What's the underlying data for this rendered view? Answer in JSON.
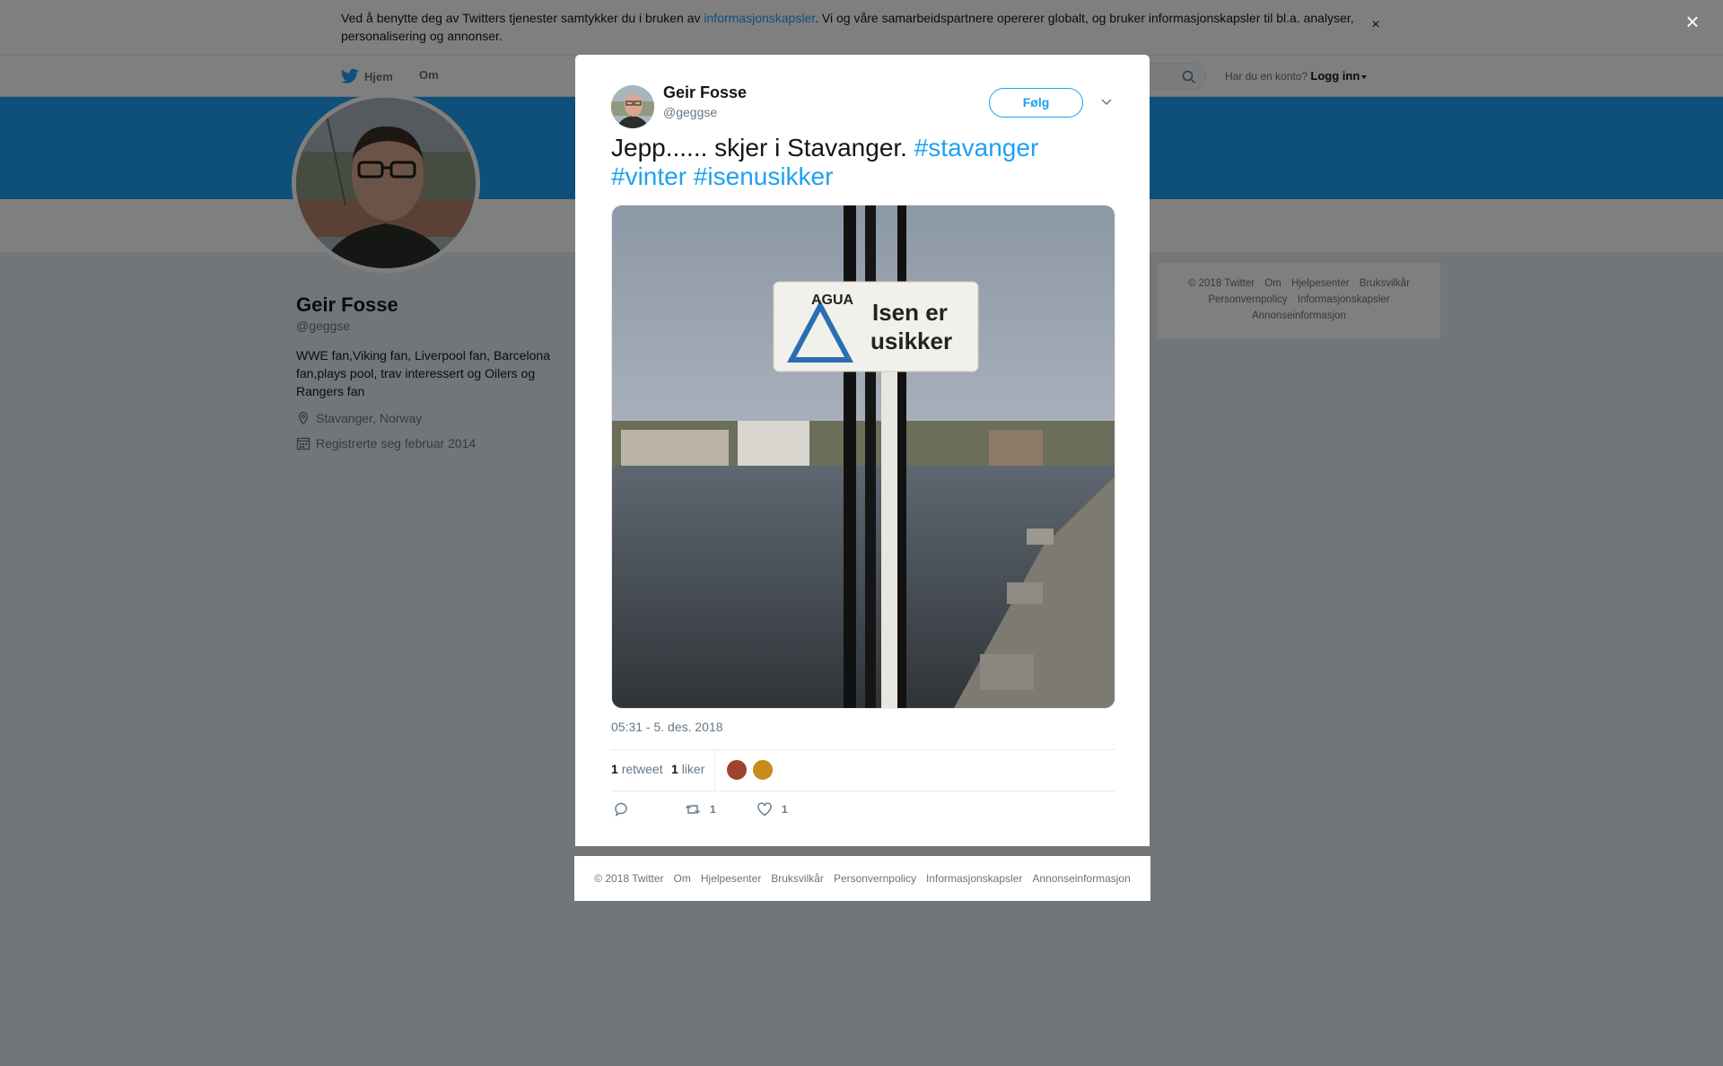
{
  "cookie_banner": {
    "text_before": "Ved å benytte deg av Twitters tjenester samtykker du i bruken av ",
    "link": "informasjonskapsler",
    "text_after": ". Vi og våre samarbeidspartnere opererer globalt, og bruker informasjonskapsler til bl.a. analyser, personalisering og annonser.",
    "close": "×"
  },
  "topnav": {
    "home": "Hjem",
    "about": "Om",
    "login_prompt": "Har du en konto?",
    "login": "Logg inn"
  },
  "profile": {
    "name": "Geir Fosse",
    "handle": "@geggse",
    "bio": "WWE fan,Viking fan, Liverpool fan, Barcelona fan,plays pool, trav interessert og Oilers og Rangers fan",
    "location": "Stavanger, Norway",
    "joined": "Registrerte seg februar 2014"
  },
  "side_footer": [
    "© 2018 Twitter",
    "Om",
    "Hjelpesenter",
    "Bruksvilkår",
    "Personvernpolicy",
    "Informasjonskapsler",
    "Annonseinformasjon"
  ],
  "overlay": {
    "close": "×"
  },
  "tweet": {
    "author_name": "Geir Fosse",
    "author_handle": "@geggse",
    "follow_label": "Følg",
    "text": "Jepp...... skjer i Stavanger. ",
    "hashtags": [
      "#stavanger",
      "#vinter",
      "#isenusikker"
    ],
    "sign_text_line1": "Isen er",
    "sign_text_line2": "usikker",
    "sign_small": "AGUA",
    "timestamp": "05:31 - 5. des. 2018",
    "retweets": {
      "count": "1",
      "label": "retweet"
    },
    "likes": {
      "count": "1",
      "label": "liker"
    },
    "actions": {
      "reply_count": "",
      "retweet_count": "1",
      "like_count": "1"
    }
  },
  "modal_footer": [
    "© 2018 Twitter",
    "Om",
    "Hjelpesenter",
    "Bruksvilkår",
    "Personvernpolicy",
    "Informasjonskapsler",
    "Annonseinformasjon"
  ],
  "colors": {
    "accent": "#1da1f2",
    "banner": "#1da1f2",
    "text": "#14171a",
    "muted": "#657786"
  },
  "icons": [
    "twitter-bird-icon",
    "search-icon",
    "caret-down-icon",
    "location-pin-icon",
    "calendar-icon",
    "close-icon",
    "chevron-down-icon",
    "reply-icon",
    "retweet-icon",
    "heart-icon"
  ]
}
